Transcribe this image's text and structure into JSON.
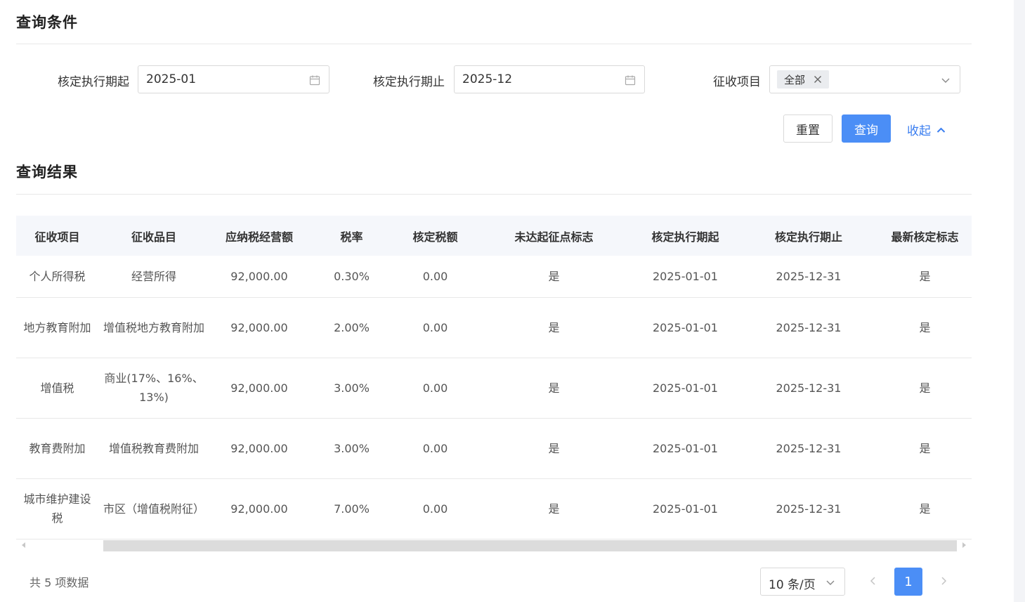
{
  "query": {
    "section_title": "查询条件",
    "start_label": "核定执行期起",
    "start_value": "2025-01",
    "end_label": "核定执行期止",
    "end_value": "2025-12",
    "item_label": "征收项目",
    "item_tag": "全部",
    "reset_label": "重置",
    "query_label": "查询",
    "collapse_label": "收起"
  },
  "results": {
    "section_title": "查询结果",
    "columns": [
      "征收项目",
      "征收品目",
      "应纳税经营额",
      "税率",
      "核定税额",
      "未达起征点标志",
      "核定执行期起",
      "核定执行期止",
      "最新核定标志"
    ],
    "rows": [
      [
        "个人所得税",
        "经营所得",
        "92,000.00",
        "0.30%",
        "0.00",
        "是",
        "2025-01-01",
        "2025-12-31",
        "是"
      ],
      [
        "地方教育附加",
        "增值税地方教育附加",
        "92,000.00",
        "2.00%",
        "0.00",
        "是",
        "2025-01-01",
        "2025-12-31",
        "是"
      ],
      [
        "增值税",
        "商业(17%、16%、13%)",
        "92,000.00",
        "3.00%",
        "0.00",
        "是",
        "2025-01-01",
        "2025-12-31",
        "是"
      ],
      [
        "教育费附加",
        "增值税教育费附加",
        "92,000.00",
        "3.00%",
        "0.00",
        "是",
        "2025-01-01",
        "2025-12-31",
        "是"
      ],
      [
        "城市维护建设税",
        "市区（增值税附征）",
        "92,000.00",
        "7.00%",
        "0.00",
        "是",
        "2025-01-01",
        "2025-12-31",
        "是"
      ]
    ]
  },
  "pagination": {
    "total_text": "共 5 项数据",
    "page_size": "10 条/页",
    "current_page": "1"
  },
  "colors": {
    "primary": "#4b8ef6",
    "link": "#3a7ef0",
    "header_bg": "#f5f7fb"
  }
}
